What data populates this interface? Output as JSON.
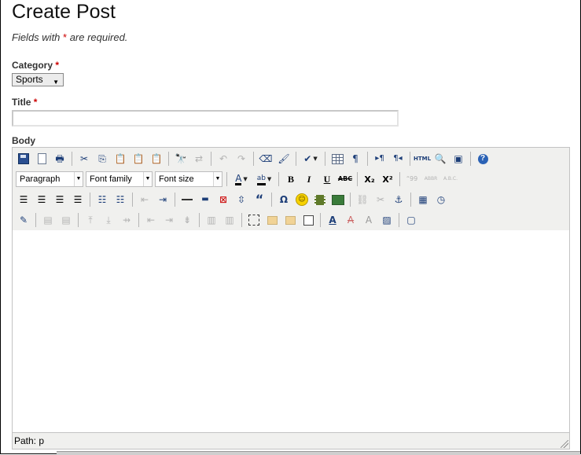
{
  "page": {
    "title": "Create Post",
    "required_note_before": "Fields with ",
    "required_star": "*",
    "required_note_after": " are required."
  },
  "form": {
    "category": {
      "label": "Category",
      "required": "*",
      "selected": "Sports"
    },
    "title": {
      "label": "Title",
      "required": "*",
      "value": ""
    },
    "body": {
      "label": "Body"
    }
  },
  "editor": {
    "format_combo": "Paragraph",
    "font_family_combo": "Font family",
    "font_size_combo": "Font size",
    "path_label": "Path: p",
    "glyphs": {
      "bold": "B",
      "italic": "I",
      "underline": "U",
      "strike": "ABC",
      "sub": "X₂",
      "sup": "X²",
      "html": "HTML",
      "omega": "Ω",
      "quote": "“",
      "cite": "“99",
      "abbr": "ABBR",
      "acronym": "A.B.C.",
      "pilcrow": "¶",
      "help": "?",
      "smile": "☺",
      "font_a": "A"
    }
  }
}
